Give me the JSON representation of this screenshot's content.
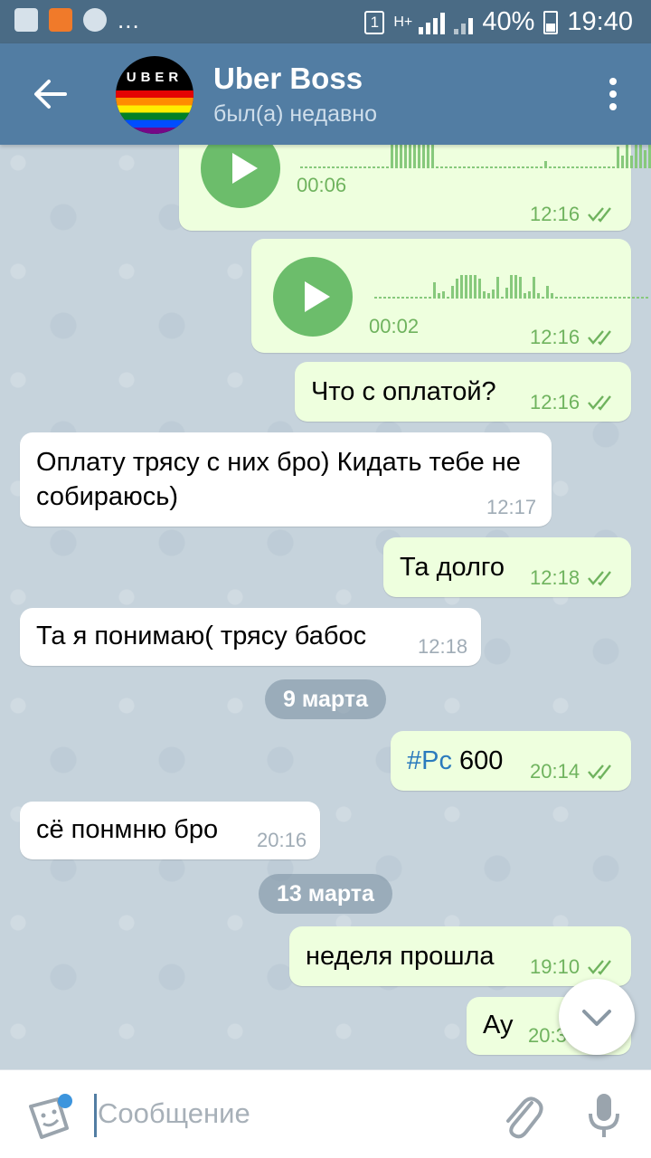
{
  "status_bar": {
    "sim_slot": "1",
    "network": "H+",
    "battery": "40%",
    "time": "19:40",
    "more": "..."
  },
  "header": {
    "title": "Uber Boss",
    "subtitle": "был(а) недавно",
    "avatar_text": "UBER"
  },
  "messages": [
    {
      "dir": "out",
      "type": "voice",
      "duration": "00:06",
      "time": "12:16",
      "read": true
    },
    {
      "dir": "out",
      "type": "voice",
      "duration": "00:02",
      "time": "12:16",
      "read": true
    },
    {
      "dir": "out",
      "type": "text",
      "text": "Что с оплатой?",
      "time": "12:16",
      "read": true
    },
    {
      "dir": "in",
      "type": "text",
      "text": "Оплату трясу с них бро) Кидать тебе не собираюсь)",
      "time": "12:17"
    },
    {
      "dir": "out",
      "type": "text",
      "text": "Та долго",
      "time": "12:18",
      "read": true
    },
    {
      "dir": "in",
      "type": "text",
      "text": "Та я понимаю( трясу бабос",
      "time": "12:18"
    },
    {
      "type": "date",
      "text": "9 марта"
    },
    {
      "dir": "out",
      "type": "text",
      "hashtag": "#Рс",
      "text": " 600",
      "time": "20:14",
      "read": true
    },
    {
      "dir": "in",
      "type": "text",
      "text": "сё понмню бро",
      "time": "20:16"
    },
    {
      "type": "date",
      "text": "13 марта"
    },
    {
      "dir": "out",
      "type": "text",
      "text": "неделя прошла",
      "time": "19:10",
      "read": true
    },
    {
      "dir": "out",
      "type": "text",
      "text": "Ау",
      "time": "20:3",
      "read": true
    }
  ],
  "input": {
    "placeholder": "Сообщение"
  },
  "icons": {
    "back": "arrow-left-icon",
    "menu": "more-vertical-icon",
    "emoji": "sticker-emoji-icon",
    "attach": "paperclip-icon",
    "mic": "microphone-icon",
    "scroll_down": "chevron-down-icon",
    "read": "double-check-icon"
  },
  "colors": {
    "header": "#527da3",
    "status_bar": "#4a6b85",
    "outgoing_bubble": "#eeffde",
    "incoming_bubble": "#ffffff",
    "time_out": "#6fb35e",
    "play_button": "#6cbd6b"
  }
}
